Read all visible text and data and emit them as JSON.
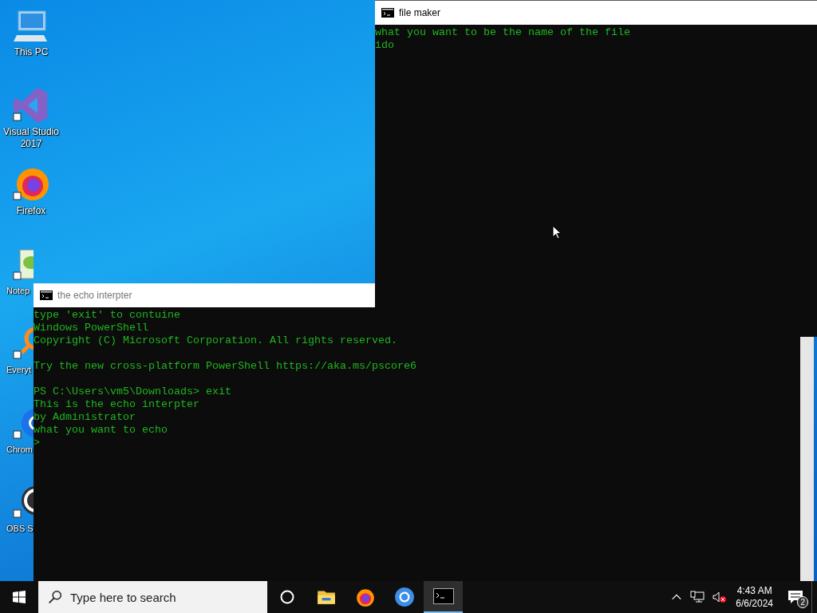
{
  "desktop": {
    "icons": [
      {
        "label": "This PC",
        "kind": "pc"
      },
      {
        "label": "Visual Studio 2017",
        "kind": "vs"
      },
      {
        "label": "Firefox",
        "kind": "firefox"
      },
      {
        "label": "Notep",
        "kind": "notepad"
      },
      {
        "label": "Everyt",
        "kind": "everything"
      },
      {
        "label": "Chrom",
        "kind": "chrome"
      },
      {
        "label": "OBS S",
        "kind": "obs"
      }
    ]
  },
  "windows": [
    {
      "title": "the echo interpter",
      "blocks": [
        [
          "type 'exit' to contuine",
          "Windows PowerShell",
          "Copyright (C) Microsoft Corporation. All rights reserved."
        ],
        [
          "Try the new cross-platform PowerShell https://aka.ms/pscore6"
        ],
        [
          "PS C:\\Users\\vm5\\Downloads> exit",
          "This is the echo interpter",
          "by Administrator",
          "what you want to echo",
          ">"
        ]
      ]
    },
    {
      "title": "file maker",
      "blocks": [
        [
          "what you want to be the name of the file",
          "ido"
        ]
      ]
    }
  ],
  "taskbar": {
    "search": {
      "placeholder": "Type here to search"
    },
    "apps": [
      {
        "kind": "taskview",
        "selected": false
      },
      {
        "kind": "folder",
        "selected": false
      },
      {
        "kind": "firefox",
        "selected": false
      },
      {
        "kind": "chrome",
        "selected": false
      },
      {
        "kind": "terminal",
        "selected": true
      }
    ],
    "clock": {
      "time": "4:43 AM",
      "date": "6/6/2024"
    },
    "notifications": {
      "count": "2"
    }
  }
}
